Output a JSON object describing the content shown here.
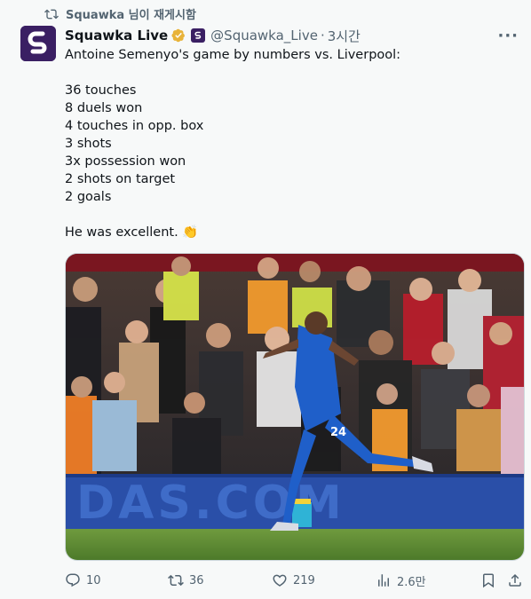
{
  "repost": {
    "label": "Squawka 님이 재게시함"
  },
  "author": {
    "name": "Squawka Live",
    "handle": "@Squawka_Live",
    "separator": "·",
    "time": "3시간"
  },
  "tweet": {
    "text": "Antoine Semenyo's game by numbers vs. Liverpool:\n\n36 touches\n8 duels won\n4 touches in opp. box\n3 shots\n3x possession won\n2 shots on target\n2 goals\n\nHe was excellent. 👏"
  },
  "media": {
    "board_text": "DAS.COM",
    "shirt_number": "24"
  },
  "actions": {
    "replies": "10",
    "reposts": "36",
    "likes": "219",
    "views": "2.6만"
  },
  "colors": {
    "accent": "#1d9bf0",
    "brand": "#3a1f63",
    "verified": "#e8b339",
    "muted": "#536471"
  }
}
